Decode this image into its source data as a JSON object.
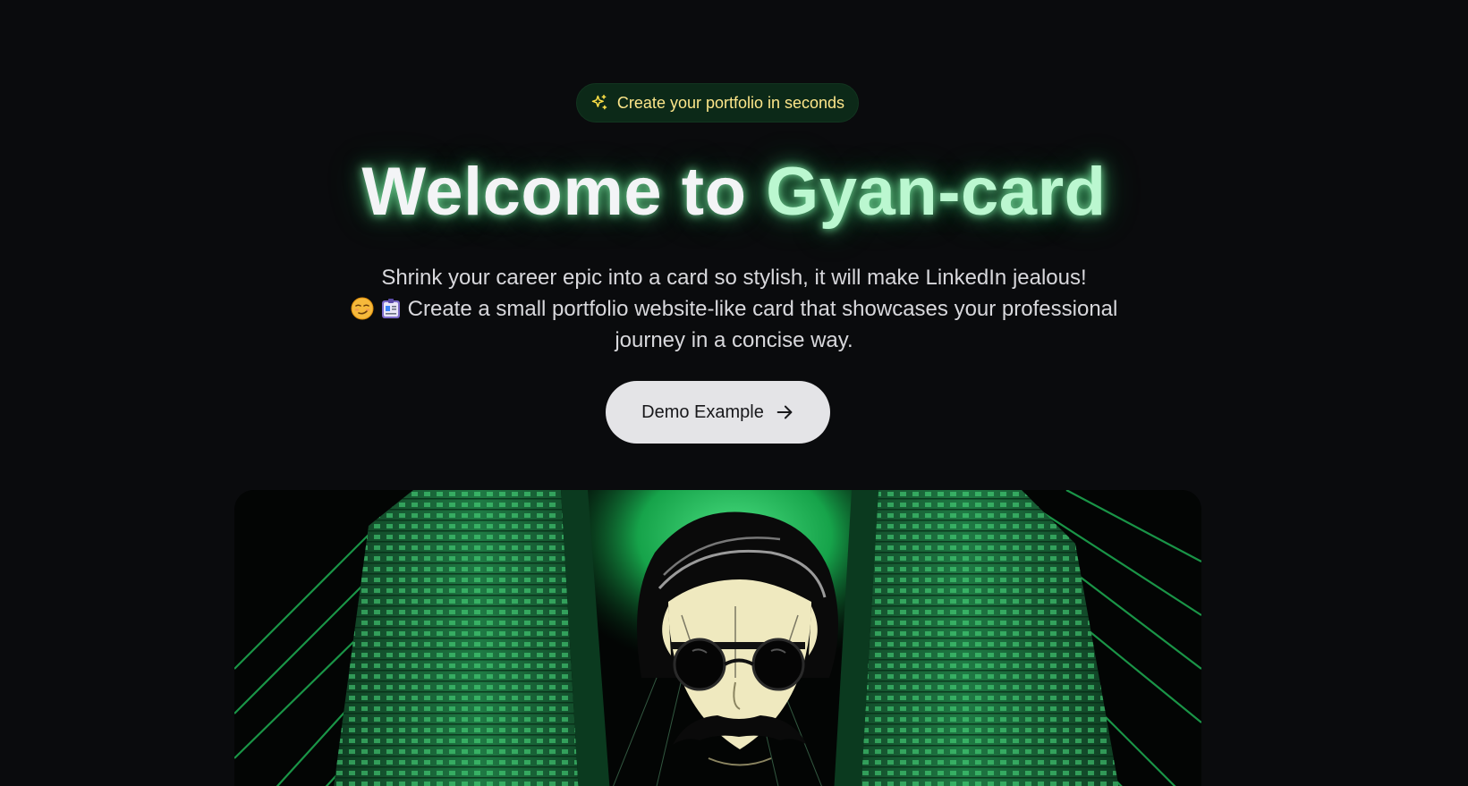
{
  "badge": {
    "icon": "sparkles-icon",
    "text": "Create your portfolio in seconds"
  },
  "hero": {
    "title_prefix": "Welcome to",
    "title_brand": "Gyan-card",
    "subtitle_line1": "Shrink your career epic into a card so stylish, it will make LinkedIn jealous!",
    "subtitle_line2": "Create a small portfolio website-like card that showcases your professional journey in a concise way.",
    "subtitle_emojis": [
      "smirking-face-emoji",
      "id-card-emoji"
    ]
  },
  "cta": {
    "label": "Demo Example",
    "icon": "arrow-right-icon"
  },
  "image": {
    "subject": "illustration of a man with sunglasses and mustache among green buildings"
  },
  "colors": {
    "background": "#0a0b0d",
    "accent_green": "#22c55e",
    "badge_bg": "#0c2918",
    "badge_text": "#fde68a",
    "button_bg": "#e4e4e7"
  }
}
